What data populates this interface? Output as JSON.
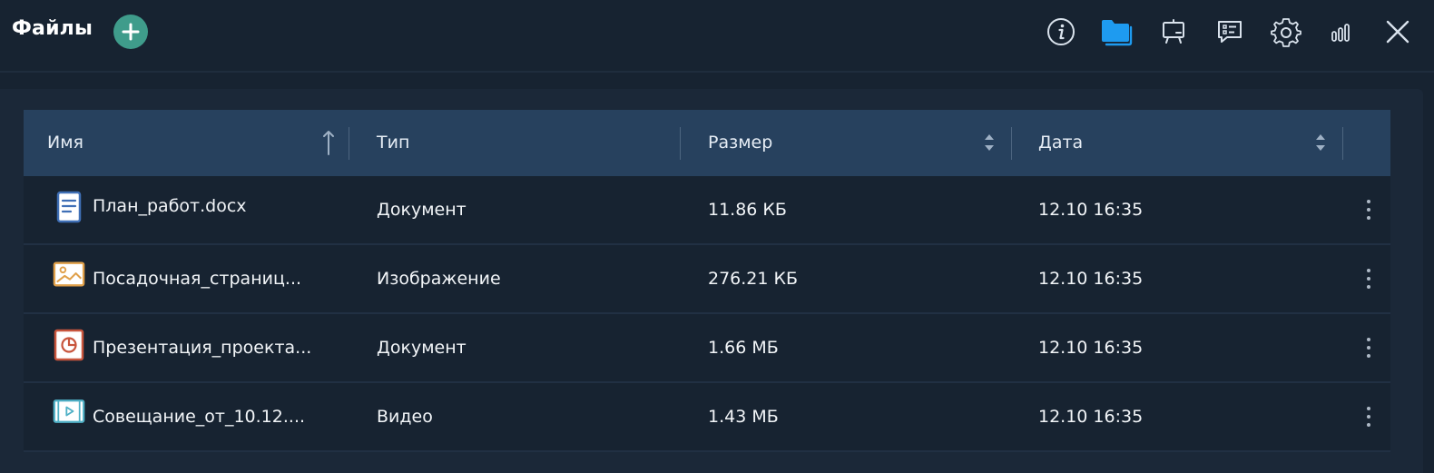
{
  "header": {
    "title": "Файлы",
    "icons": [
      "info-icon",
      "folder-icon",
      "whiteboard-icon",
      "chat-list-icon",
      "gear-icon",
      "signal-icon",
      "close-icon"
    ],
    "accent_color": "#1e9bf0",
    "add_button_color": "#3f9c8b"
  },
  "table": {
    "columns": [
      {
        "label": "Имя",
        "sort": "ascending"
      },
      {
        "label": "Тип",
        "sort": "none"
      },
      {
        "label": "Размер",
        "sort": "both"
      },
      {
        "label": "Дата",
        "sort": "both"
      }
    ],
    "rows": [
      {
        "name": "План_работ.docx",
        "type": "Документ",
        "size": "11.86 КБ",
        "date": "12.10 16:35",
        "icon": "document-icon",
        "icon_color": "#3f6fb6"
      },
      {
        "name": "Посадочная_страниц...",
        "type": "Изображение",
        "size": "276.21 КБ",
        "date": "12.10 16:35",
        "icon": "image-icon",
        "icon_color": "#e0a04a"
      },
      {
        "name": "Презентация_проекта...",
        "type": "Документ",
        "size": "1.66 МБ",
        "date": "12.10 16:35",
        "icon": "presentation-icon",
        "icon_color": "#c8553d"
      },
      {
        "name": "Совещание_от_10.12....",
        "type": "Видео",
        "size": "1.43 МБ",
        "date": "12.10 16:35",
        "icon": "video-icon",
        "icon_color": "#4fb0c6"
      }
    ]
  }
}
